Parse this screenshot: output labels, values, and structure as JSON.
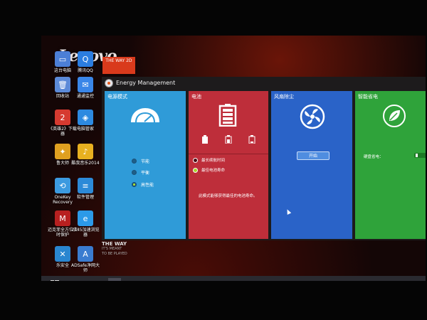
{
  "desktop": {
    "logo_text": "Lenovo",
    "badge_text": "THE WAY 2D",
    "icons": [
      {
        "label": "这台电脑",
        "color": "#4c7fd6",
        "glyph": "▭"
      },
      {
        "label": "腾讯QQ",
        "color": "#2b7de0",
        "glyph": "Q"
      },
      {
        "label": "回收站",
        "color": "#5c8ad8",
        "glyph": "🗑"
      },
      {
        "label": "通通监控",
        "color": "#3a86e8",
        "glyph": "✉"
      },
      {
        "label": "《英雄2》下载器",
        "color": "#d63a30",
        "glyph": "2"
      },
      {
        "label": "电脑管家",
        "color": "#2d8ae0",
        "glyph": "◈"
      },
      {
        "label": "鲁大师",
        "color": "#e0a020",
        "glyph": "✦"
      },
      {
        "label": "酷我音乐2014",
        "color": "#e8b020",
        "glyph": "♪"
      },
      {
        "label": "OneKey Recovery",
        "color": "#3c9ae0",
        "glyph": "⟲"
      },
      {
        "label": "软件管理",
        "color": "#2c8ad8",
        "glyph": "≡"
      },
      {
        "label": "迈克菲全方位实时保护",
        "color": "#b82020",
        "glyph": "M"
      },
      {
        "label": "2345加速浏览器",
        "color": "#2c9ae8",
        "glyph": "e"
      },
      {
        "label": "乐安全",
        "color": "#2a86d0",
        "glyph": "✕"
      },
      {
        "label": "ADSafe净网大师",
        "color": "#3a7cd0",
        "glyph": "A"
      }
    ],
    "slogan_line1": "THE WAY",
    "slogan_line2": "IT'S MEANT",
    "slogan_line3": "TO BE PLAYED"
  },
  "window": {
    "title": "Energy Management",
    "panels": {
      "power_mode": {
        "title": "电源模式",
        "options": [
          {
            "label": "节能",
            "selected": false
          },
          {
            "label": "平衡",
            "selected": false
          },
          {
            "label": "高性能",
            "selected": true
          }
        ]
      },
      "battery": {
        "title": "电池",
        "options": [
          {
            "label": "最长续航时间",
            "selected": false
          },
          {
            "label": "最佳电池寿命",
            "selected": true
          }
        ],
        "description": "此模式能够获得最佳的电池寿命。"
      },
      "dust": {
        "title": "风扇除尘",
        "start_label": "开始"
      },
      "smart": {
        "title": "智能省电",
        "option_label": "硬盘省电："
      }
    }
  },
  "taskbar": {
    "items": [
      "start",
      "explorer",
      "store",
      "energy"
    ]
  }
}
